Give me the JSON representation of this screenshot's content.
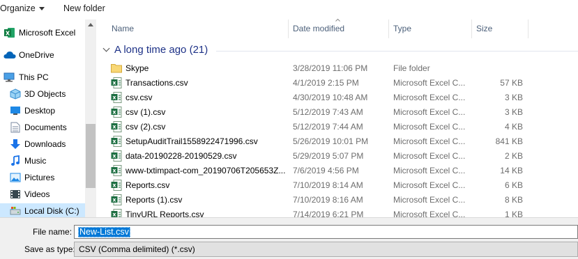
{
  "toolbar": {
    "organize_label": "Organize",
    "new_folder_label": "New folder"
  },
  "nav": {
    "items": [
      {
        "label": "Microsoft Excel",
        "icon": "excel-icon"
      },
      {
        "label": "OneDrive",
        "icon": "onedrive-cloud-icon"
      },
      {
        "label": "This PC",
        "icon": "computer-icon"
      },
      {
        "label": "3D Objects",
        "icon": "3d-objects-icon"
      },
      {
        "label": "Desktop",
        "icon": "desktop-icon"
      },
      {
        "label": "Documents",
        "icon": "documents-icon"
      },
      {
        "label": "Downloads",
        "icon": "downloads-icon"
      },
      {
        "label": "Music",
        "icon": "music-icon"
      },
      {
        "label": "Pictures",
        "icon": "pictures-icon"
      },
      {
        "label": "Videos",
        "icon": "videos-icon"
      },
      {
        "label": "Local Disk (C:)",
        "icon": "local-disk-icon",
        "selected": true
      }
    ]
  },
  "columns": {
    "name": "Name",
    "date": "Date modified",
    "type": "Type",
    "size": "Size"
  },
  "group": {
    "label": "A long time ago (21)"
  },
  "files": [
    {
      "name": "Skype",
      "date": "3/28/2019 11:06 PM",
      "type": "File folder",
      "size": "",
      "icon": "folder-icon"
    },
    {
      "name": "Transactions.csv",
      "date": "4/1/2019 2:15 PM",
      "type": "Microsoft Excel C...",
      "size": "57 KB",
      "icon": "excel-csv-icon"
    },
    {
      "name": "csv.csv",
      "date": "4/30/2019 10:48 AM",
      "type": "Microsoft Excel C...",
      "size": "3 KB",
      "icon": "excel-csv-icon"
    },
    {
      "name": "csv (1).csv",
      "date": "5/12/2019 7:43 AM",
      "type": "Microsoft Excel C...",
      "size": "3 KB",
      "icon": "excel-csv-icon"
    },
    {
      "name": "csv (2).csv",
      "date": "5/12/2019 7:44 AM",
      "type": "Microsoft Excel C...",
      "size": "4 KB",
      "icon": "excel-csv-icon"
    },
    {
      "name": "SetupAuditTrail1558922471996.csv",
      "date": "5/26/2019 10:01 PM",
      "type": "Microsoft Excel C...",
      "size": "841 KB",
      "icon": "excel-csv-icon"
    },
    {
      "name": "data-20190228-20190529.csv",
      "date": "5/29/2019 5:07 PM",
      "type": "Microsoft Excel C...",
      "size": "2 KB",
      "icon": "excel-csv-icon"
    },
    {
      "name": "www-txtimpact-com_20190706T205653Z...",
      "date": "7/6/2019 4:56 PM",
      "type": "Microsoft Excel C...",
      "size": "14 KB",
      "icon": "excel-csv-icon"
    },
    {
      "name": "Reports.csv",
      "date": "7/10/2019 8:14 AM",
      "type": "Microsoft Excel C...",
      "size": "6 KB",
      "icon": "excel-csv-icon"
    },
    {
      "name": "Reports (1).csv",
      "date": "7/10/2019 8:16 AM",
      "type": "Microsoft Excel C...",
      "size": "8 KB",
      "icon": "excel-csv-icon"
    },
    {
      "name": "TinyURL Reports.csv",
      "date": "7/14/2019 6:21 PM",
      "type": "Microsoft Excel C...",
      "size": "1 KB",
      "icon": "excel-csv-icon"
    }
  ],
  "bottom": {
    "file_name_label": "File name:",
    "file_name_value": "New-List.csv",
    "save_as_type_label": "Save as type:",
    "save_as_type_value": "CSV (Comma delimited) (*.csv)"
  },
  "colors": {
    "accent": "#0078d7",
    "selection": "#cce8ff",
    "group_text": "#1e3287",
    "excel_green": "#1d6f42",
    "folder_yellow": "#f8d775"
  }
}
